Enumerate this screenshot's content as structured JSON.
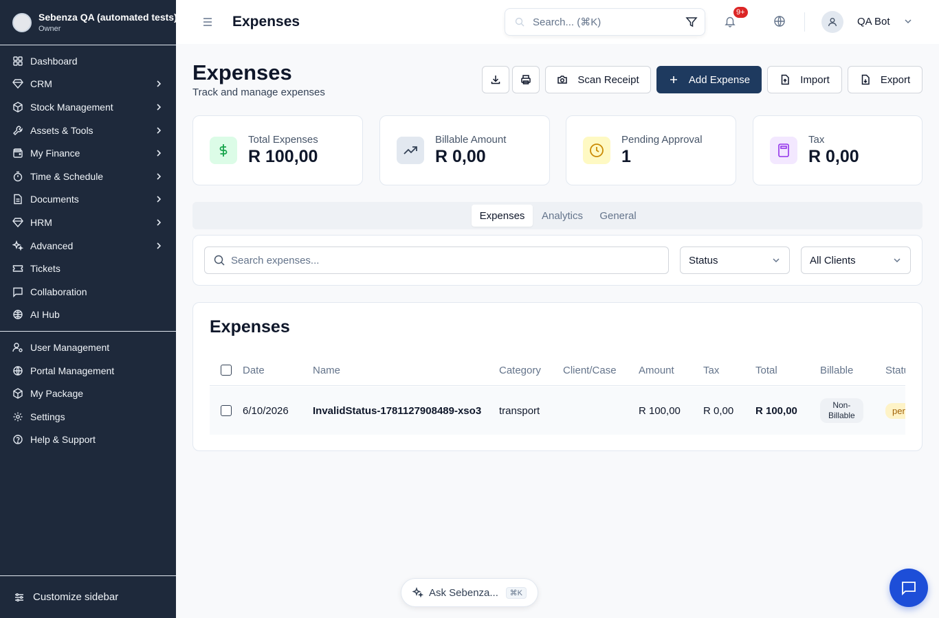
{
  "org": {
    "name": "Sebenza QA (automated tests)",
    "role": "Owner"
  },
  "sidebar": {
    "items": [
      {
        "label": "Dashboard",
        "icon": "dashboard-icon",
        "has_children": false
      },
      {
        "label": "CRM",
        "icon": "gem-icon",
        "has_children": true
      },
      {
        "label": "Stock Management",
        "icon": "package-icon",
        "has_children": true
      },
      {
        "label": "Assets & Tools",
        "icon": "wrench-icon",
        "has_children": true
      },
      {
        "label": "My Finance",
        "icon": "wallet-icon",
        "has_children": true
      },
      {
        "label": "Time & Schedule",
        "icon": "timer-icon",
        "has_children": true
      },
      {
        "label": "Documents",
        "icon": "document-icon",
        "has_children": true
      },
      {
        "label": "HRM",
        "icon": "gem-icon",
        "has_children": true
      },
      {
        "label": "Advanced",
        "icon": "sparkles-icon",
        "has_children": true
      },
      {
        "label": "Tickets",
        "icon": "ticket-icon",
        "has_children": false
      },
      {
        "label": "Collaboration",
        "icon": "message-square-icon",
        "has_children": false
      },
      {
        "label": "AI Hub",
        "icon": "brain-icon",
        "has_children": false
      }
    ],
    "items2": [
      {
        "label": "User Management",
        "icon": "user-cog-icon"
      },
      {
        "label": "Portal Management",
        "icon": "globe-icon"
      },
      {
        "label": "My Package",
        "icon": "package-icon"
      },
      {
        "label": "Settings",
        "icon": "gear-icon"
      },
      {
        "label": "Help & Support",
        "icon": "help-circle-icon"
      }
    ],
    "customize_label": "Customize sidebar"
  },
  "topbar": {
    "title": "Expenses",
    "search_placeholder": "Search... (⌘K)",
    "notification_badge": "9+",
    "user_name": "QA Bot"
  },
  "page": {
    "title": "Expenses",
    "subtitle": "Track and manage expenses",
    "buttons": {
      "scan_receipt": "Scan Receipt",
      "add_expense": "Add Expense",
      "import": "Import",
      "export": "Export"
    }
  },
  "stats": [
    {
      "label": "Total Expenses",
      "value": "R 100,00",
      "color": "#16a34a",
      "bg": "#dcfce7"
    },
    {
      "label": "Billable Amount",
      "value": "R 0,00",
      "color": "#334155",
      "bg": "#e2e8f0"
    },
    {
      "label": "Pending Approval",
      "value": "1",
      "color": "#ca8a04",
      "bg": "#fef9c3"
    },
    {
      "label": "Tax",
      "value": "R 0,00",
      "color": "#9333ea",
      "bg": "#f3e8ff"
    }
  ],
  "tabs": [
    "Expenses",
    "Analytics",
    "General"
  ],
  "filters": {
    "search_placeholder": "Search expenses...",
    "status": "Status",
    "clients": "All Clients"
  },
  "table": {
    "title": "Expenses",
    "columns": [
      "Date",
      "Name",
      "Category",
      "Client/Case",
      "Amount",
      "Tax",
      "Total",
      "Billable",
      "Status"
    ],
    "rows": [
      {
        "date": "6/10/2026",
        "name": "InvalidStatus-1781127908489-xso3",
        "category": "transport",
        "client": "",
        "amount": "R 100,00",
        "tax": "R 0,00",
        "total": "R 100,00",
        "billable_line1": "Non-",
        "billable_line2": "Billable",
        "status": "pending"
      }
    ]
  },
  "ask": {
    "label": "Ask Sebenza...",
    "shortcut": "⌘K"
  }
}
